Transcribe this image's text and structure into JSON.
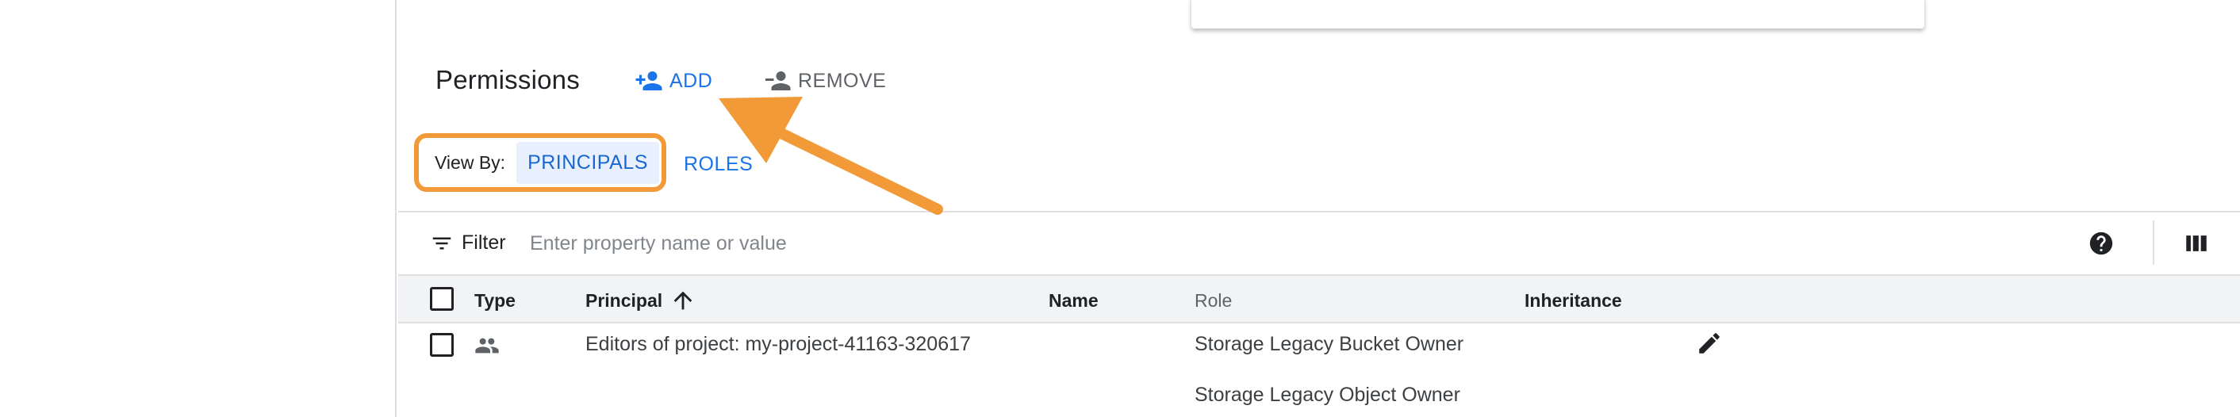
{
  "permissions": {
    "title": "Permissions",
    "add_label": "ADD",
    "remove_label": "REMOVE"
  },
  "view_by": {
    "label": "View By:",
    "principals_label": "PRINCIPALS",
    "roles_label": "ROLES"
  },
  "filter": {
    "label": "Filter",
    "placeholder": "Enter property name or value"
  },
  "table": {
    "columns": {
      "type": "Type",
      "principal": "Principal",
      "name": "Name",
      "role": "Role",
      "inheritance": "Inheritance"
    },
    "rows": [
      {
        "type_icon": "group-icon",
        "principal": "Editors of project: my-project-41163-320617",
        "name": "",
        "roles": [
          "Storage Legacy Bucket Owner",
          "Storage Legacy Object Owner"
        ],
        "inheritance": ""
      }
    ]
  },
  "colors": {
    "accent_blue": "#1a73e8",
    "chip_bg": "#e8f0fe",
    "annotation_orange": "#f29a38",
    "header_bg": "#f1f3f4"
  },
  "icons": [
    "person-add-icon",
    "person-remove-icon",
    "filter-icon",
    "help-icon",
    "column-display-icon",
    "arrow-upward-icon",
    "group-icon",
    "edit-icon"
  ]
}
